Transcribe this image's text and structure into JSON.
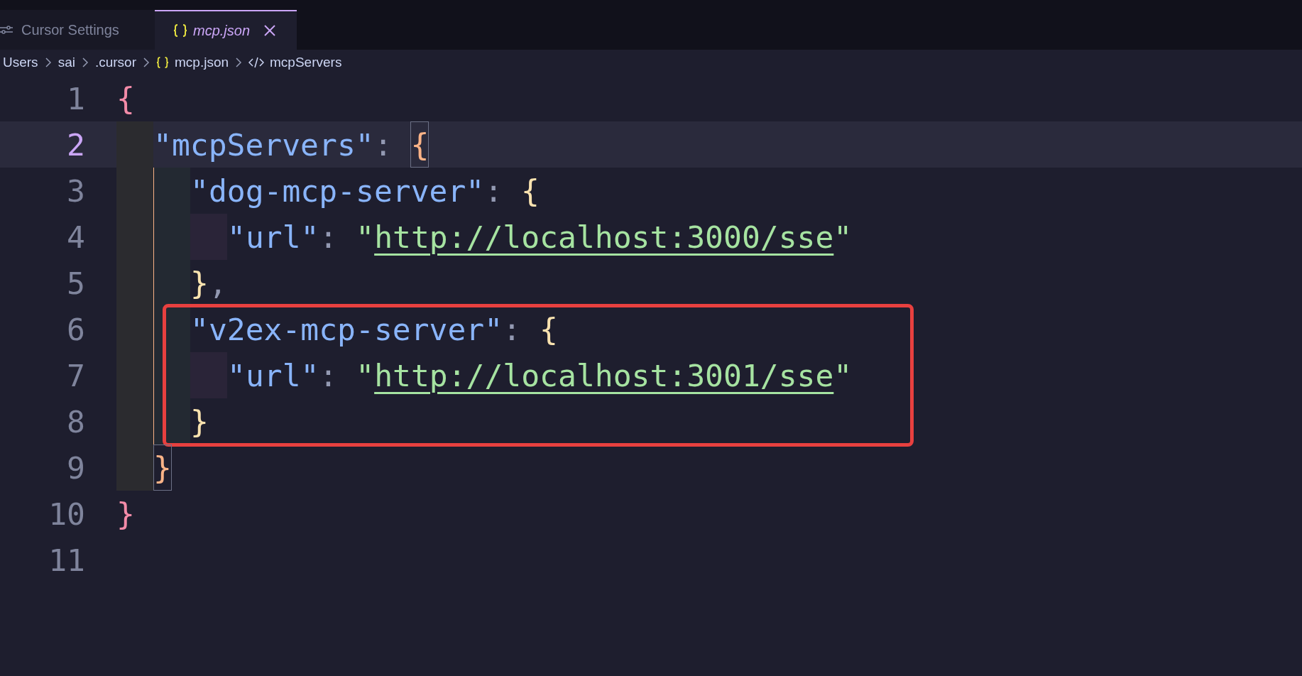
{
  "tabs": [
    {
      "label": "Cursor Settings",
      "kind": "settings",
      "selected": false
    },
    {
      "label": "mcp.json",
      "kind": "file",
      "selected": true
    }
  ],
  "breadcrumbs": [
    {
      "label": "Users",
      "kind": "folder"
    },
    {
      "label": "sai",
      "kind": "folder"
    },
    {
      "label": ".cursor",
      "kind": "folder"
    },
    {
      "label": "mcp.json",
      "kind": "file"
    },
    {
      "label": "mcpServers",
      "kind": "symbol"
    }
  ],
  "lines": [
    {
      "number": "1",
      "selected": false,
      "boxed": false,
      "tokens": [
        {
          "text": "{",
          "kind": "brace1",
          "matched": false
        }
      ]
    },
    {
      "number": "2",
      "selected": true,
      "boxed": false,
      "tokens": [
        {
          "text": "\"mcpServers\"",
          "kind": "key",
          "matched": false
        },
        {
          "text": ": ",
          "kind": "punct",
          "matched": false
        },
        {
          "text": "{",
          "kind": "brace2",
          "matched": true
        }
      ]
    },
    {
      "number": "3",
      "selected": false,
      "boxed": false,
      "tokens": [
        {
          "text": "\"dog-mcp-server\"",
          "kind": "key",
          "matched": false
        },
        {
          "text": ": ",
          "kind": "punct",
          "matched": false
        },
        {
          "text": "{",
          "kind": "brace3",
          "matched": false
        }
      ]
    },
    {
      "number": "4",
      "selected": false,
      "boxed": false,
      "tokens": [
        {
          "text": "\"url\"",
          "kind": "key",
          "matched": false
        },
        {
          "text": ": ",
          "kind": "punct",
          "matched": false
        },
        {
          "text": "\"",
          "kind": "string",
          "matched": false
        },
        {
          "text": "http://localhost:3000/sse",
          "kind": "url",
          "matched": false
        },
        {
          "text": "\"",
          "kind": "string",
          "matched": false
        }
      ]
    },
    {
      "number": "5",
      "selected": false,
      "boxed": false,
      "tokens": [
        {
          "text": "}",
          "kind": "brace3",
          "matched": false
        },
        {
          "text": ",",
          "kind": "punct",
          "matched": false
        }
      ]
    },
    {
      "number": "6",
      "selected": false,
      "boxed": true,
      "tokens": [
        {
          "text": "\"v2ex-mcp-server\"",
          "kind": "key",
          "matched": false
        },
        {
          "text": ": ",
          "kind": "punct",
          "matched": false
        },
        {
          "text": "{",
          "kind": "brace3",
          "matched": false
        }
      ]
    },
    {
      "number": "7",
      "selected": false,
      "boxed": true,
      "tokens": [
        {
          "text": "\"url\"",
          "kind": "key",
          "matched": false
        },
        {
          "text": ": ",
          "kind": "punct",
          "matched": false
        },
        {
          "text": "\"",
          "kind": "string",
          "matched": false
        },
        {
          "text": "http://localhost:3001/sse",
          "kind": "url",
          "matched": false
        },
        {
          "text": "\"",
          "kind": "string",
          "matched": false
        }
      ]
    },
    {
      "number": "8",
      "selected": false,
      "boxed": true,
      "tokens": [
        {
          "text": "}",
          "kind": "brace3",
          "matched": false
        }
      ]
    },
    {
      "number": "9",
      "selected": false,
      "boxed": false,
      "tokens": [
        {
          "text": "}",
          "kind": "brace2",
          "matched": true
        }
      ]
    },
    {
      "number": "10",
      "selected": false,
      "boxed": false,
      "tokens": [
        {
          "text": "}",
          "kind": "brace1",
          "matched": false
        }
      ]
    },
    {
      "number": "11",
      "selected": false,
      "boxed": false
    }
  ]
}
